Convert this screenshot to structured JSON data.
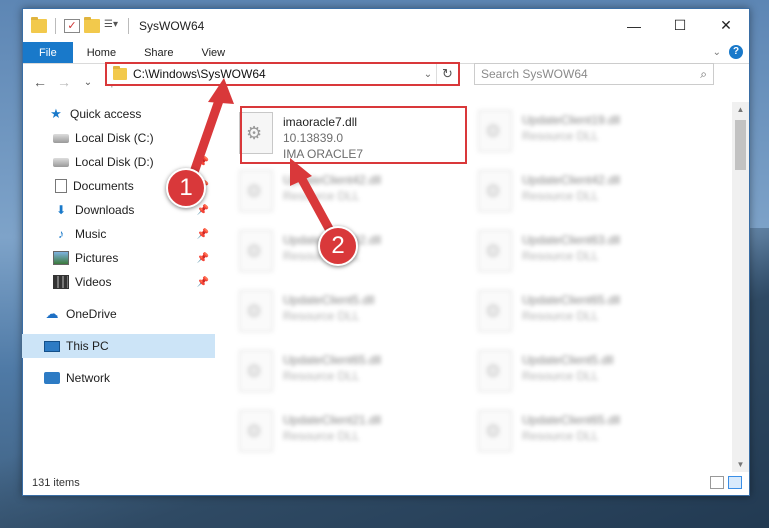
{
  "window": {
    "title": "SysWOW64",
    "caption": {
      "minimize": "—",
      "maximize": "☐",
      "close": "✕"
    }
  },
  "ribbon": {
    "tabs": [
      "File",
      "Home",
      "Share",
      "View"
    ],
    "help": "?"
  },
  "nav": {
    "back": "←",
    "forward": "→",
    "recent": "⌄",
    "up": "↑",
    "address": "C:\\Windows\\SysWOW64",
    "search_placeholder": "Search SysWOW64"
  },
  "sidebar": {
    "items": [
      {
        "label": "Quick access",
        "icon": "star-icon"
      },
      {
        "label": "Local Disk (C:)",
        "icon": "drive-icon"
      },
      {
        "label": "Local Disk (D:)",
        "icon": "drive-icon"
      },
      {
        "label": "Documents",
        "icon": "documents-icon"
      },
      {
        "label": "Downloads",
        "icon": "download-icon"
      },
      {
        "label": "Music",
        "icon": "music-icon"
      },
      {
        "label": "Pictures",
        "icon": "pictures-icon"
      },
      {
        "label": "Videos",
        "icon": "videos-icon"
      },
      {
        "label": "OneDrive",
        "icon": "cloud-icon"
      },
      {
        "label": "This PC",
        "icon": "computer-icon"
      },
      {
        "label": "Network",
        "icon": "network-icon"
      }
    ]
  },
  "files": [
    {
      "name": "imaoracle7.dll",
      "line2": "10.13839.0",
      "line3": "IMA ORACLE7"
    },
    {
      "name": "UpdateClient19.dll",
      "line2": "Resource DLL"
    },
    {
      "name": "UpdateClient42.dll",
      "line2": "Resource DLL"
    },
    {
      "name": "UpdateClient42.dll",
      "line2": "Resource DLL"
    },
    {
      "name": "UpdateClient42.dll",
      "line2": "Resource DLL"
    },
    {
      "name": "UpdateClient63.dll",
      "line2": "Resource DLL"
    },
    {
      "name": "UpdateClient5.dll",
      "line2": "Resource DLL"
    },
    {
      "name": "UpdateClient65.dll",
      "line2": "Resource DLL"
    },
    {
      "name": "UpdateClient65.dll",
      "line2": "Resource DLL"
    },
    {
      "name": "UpdateClient5.dll",
      "line2": "Resource DLL"
    },
    {
      "name": "UpdateClient21.dll",
      "line2": "Resource DLL"
    },
    {
      "name": "UpdateClient65.dll",
      "line2": "Resource DLL"
    }
  ],
  "status": {
    "count": "131 items"
  },
  "annotations": {
    "step1": "1",
    "step2": "2",
    "color": "#d9383a"
  }
}
